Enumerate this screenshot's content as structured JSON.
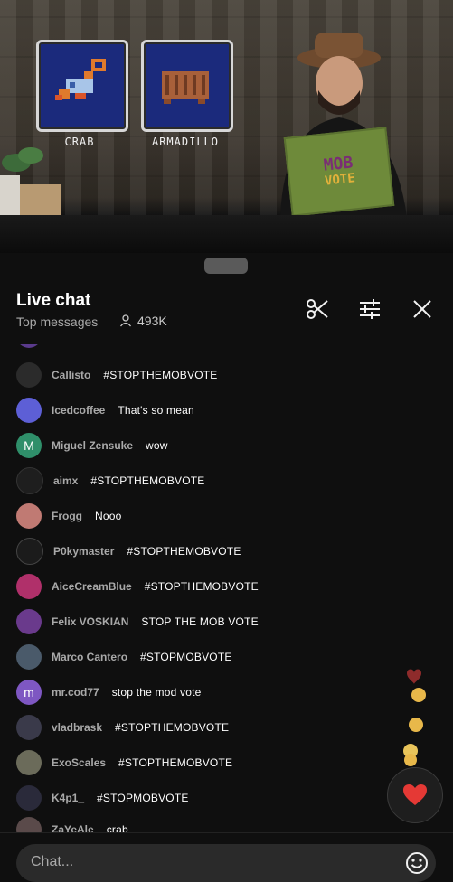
{
  "video": {
    "vote_options": [
      {
        "label": "CRAB"
      },
      {
        "label": "ARMADILLO"
      }
    ],
    "card_text_top": "MOB",
    "card_text_bottom": "VOTE"
  },
  "chat": {
    "title": "Live chat",
    "filter_label": "Top messages",
    "viewer_count": "493K",
    "input_placeholder": "Chat...",
    "icons": {
      "clip": "scissors-icon",
      "settings": "sliders-icon",
      "close": "close-icon",
      "emoji": "emoji-icon",
      "heart": "heart-icon"
    },
    "messages": [
      {
        "author": "Callisto",
        "text": "#STOPTHEMOBVOTE",
        "avatar_color": "#2b2b2b",
        "avatar_letter": ""
      },
      {
        "author": "Icedcoffee",
        "text": "That's so mean",
        "avatar_color": "#5d5fd6",
        "avatar_letter": ""
      },
      {
        "author": "Miguel Zensuke",
        "text": "wow",
        "avatar_color": "#2f8f6a",
        "avatar_letter": "M"
      },
      {
        "author": "aimx",
        "text": "#STOPTHEMOBVOTE",
        "avatar_color": "#1e1e1e",
        "avatar_letter": ""
      },
      {
        "author": "Frogg",
        "text": "Nooo",
        "avatar_color": "#c07a73",
        "avatar_letter": ""
      },
      {
        "author": "P0kymaster",
        "text": "#STOPTHEMOBVOTE",
        "avatar_color": "#1b1b1b",
        "avatar_letter": ""
      },
      {
        "author": "AiceCreamBlue",
        "text": "#STOPTHEMOBVOTE",
        "avatar_color": "#b0306a",
        "avatar_letter": ""
      },
      {
        "author": "Felix VOSKIAN",
        "text": "STOP THE MOB VOTE",
        "avatar_color": "#6a3a8c",
        "avatar_letter": ""
      },
      {
        "author": "Marco Cantero",
        "text": "#STOPMOBVOTE",
        "avatar_color": "#4a5a6a",
        "avatar_letter": ""
      },
      {
        "author": "mr.cod77",
        "text": "stop the mod vote",
        "avatar_color": "#7e57c2",
        "avatar_letter": "m"
      },
      {
        "author": "vladbrask",
        "text": "#STOPTHEMOBVOTE",
        "avatar_color": "#3a3a4a",
        "avatar_letter": ""
      },
      {
        "author": "ExoScales",
        "text": "#STOPTHEMOBVOTE",
        "avatar_color": "#6b6b5a",
        "avatar_letter": ""
      },
      {
        "author": "K4p1_",
        "text": "#STOPMOBVOTE",
        "avatar_color": "#2a2a3a",
        "avatar_letter": ""
      },
      {
        "author": "ZaYeAle",
        "text": "crab",
        "avatar_color": "#5a4a4a",
        "avatar_letter": ""
      }
    ]
  }
}
